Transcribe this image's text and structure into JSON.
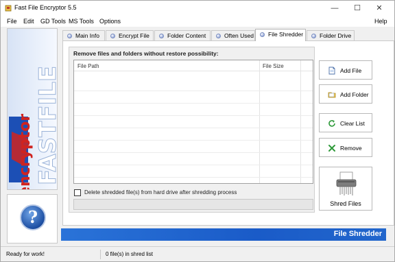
{
  "window": {
    "title": "Fast File Encryptor 5.5",
    "controls": {
      "minimize": "—",
      "maximize": "☐",
      "close": "✕"
    }
  },
  "menu": {
    "items": [
      "File",
      "Edit",
      "GD Tools",
      "MS Tools",
      "Options"
    ],
    "help": "Help"
  },
  "branding": {
    "logo_main": "FASTFILE",
    "logo_sub": "encryptor",
    "help_icon_glyph": "?"
  },
  "tabs": [
    {
      "label": "Main Info",
      "active": false
    },
    {
      "label": "Encrypt File",
      "active": false
    },
    {
      "label": "Folder Content",
      "active": false
    },
    {
      "label": "Often Used",
      "active": false
    },
    {
      "label": "File Shredder",
      "active": true
    },
    {
      "label": "Folder Drive",
      "active": false
    }
  ],
  "shredder": {
    "group_title": "Remove files and folders without restore possibility:",
    "columns": [
      "File Path",
      "File Size"
    ],
    "rows": [],
    "delete_checkbox": {
      "label": "Delete shredded file(s) from hard drive after shredding process",
      "checked": false
    },
    "buttons": {
      "add_file": "Add File",
      "add_folder": "Add Folder",
      "clear_list": "Clear List",
      "remove": "Remove",
      "shred_files": "Shred Files"
    }
  },
  "banner": {
    "text": "File Shredder"
  },
  "status": {
    "left": "Ready for work!",
    "right": "0 file(s) in shred list"
  },
  "colors": {
    "accent": "#1a5bc8",
    "logo_red": "#d0231f",
    "tab_bullet": "#8a9fd6"
  }
}
